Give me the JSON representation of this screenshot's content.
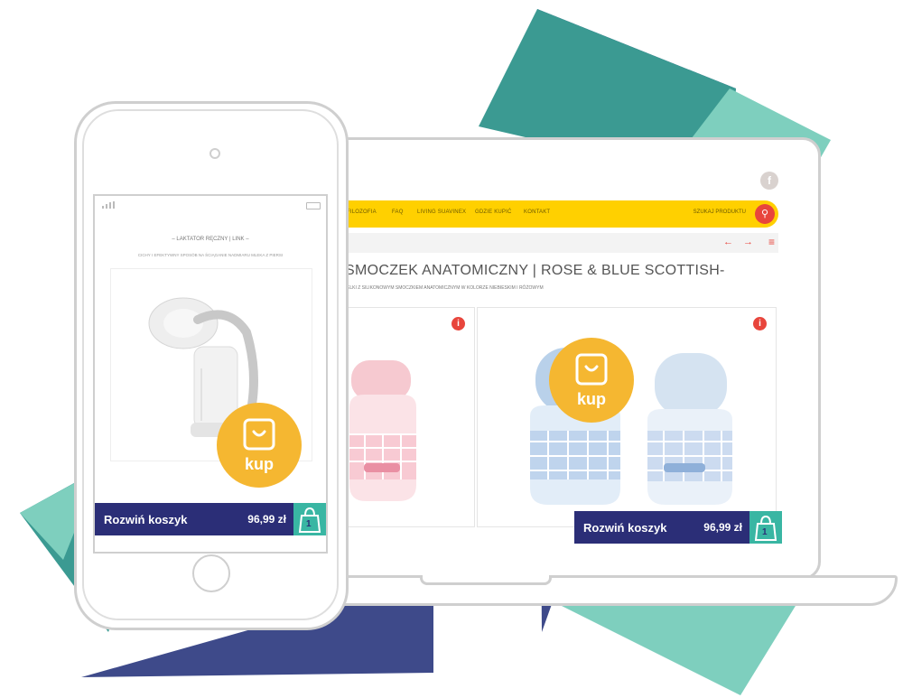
{
  "colors": {
    "navy": "#3e4a8a",
    "teal": "#3b9a92",
    "mint": "#7ecfbe",
    "nav_yellow": "#ffd000",
    "accent_red": "#e8453c",
    "cart_navy": "#2b2e77",
    "cart_teal": "#39b6a3",
    "kup_orange": "#f5b731"
  },
  "desktop": {
    "social_icon": "facebook-icon",
    "nav": {
      "items": [
        "FILOZOFIA",
        "FAQ",
        "LIVING SUAVINEX",
        "GDZIE KUPIĆ",
        "KONTAKT"
      ],
      "search_label": "SZUKAJ PRODUKTU"
    },
    "product_title": "SMOCZEK ANATOMICZNY | ROSE & BLUE SCOTTISH-",
    "product_subtitle": "ELKI Z SILIKONOWYM SMOCZKIEM ANATOMICZNYM W KOLORZE NIEBIESKIM I RÓŻOWYM",
    "kup_label": "kup",
    "cart": {
      "label": "Rozwiń koszyk",
      "total": "96,99 zł",
      "count": "1"
    }
  },
  "mobile": {
    "product_title": "– LAKTATOR RĘCZNY | LINK –",
    "product_subtitle": "CICHY I EFEKTYWNY SPOSÓB NA ŚCIĄGANIE NADMIARU MLEKA Z PIERSI",
    "kup_label": "kup",
    "cart": {
      "label": "Rozwiń koszyk",
      "total": "96,99 zł",
      "count": "1"
    }
  }
}
